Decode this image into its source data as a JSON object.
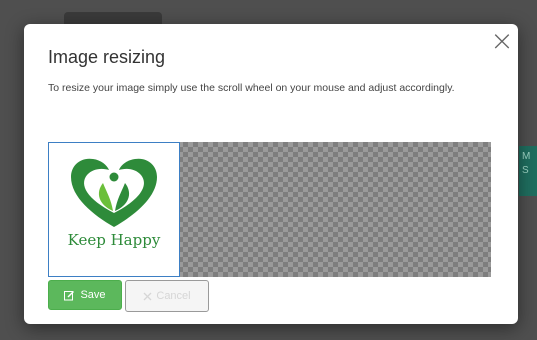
{
  "modal": {
    "title": "Image resizing",
    "description": "To resize your image simply use the scroll wheel on your mouse and adjust accordingly.",
    "close_glyph": "×"
  },
  "image": {
    "logo_text": "Keep Happy"
  },
  "buttons": {
    "save_label": "Save",
    "cancel_label": "Cancel"
  },
  "background": {
    "teal_text": "M\nS"
  },
  "colors": {
    "save": "#5cb85c",
    "logo_green": "#2e8b3a",
    "frame_border": "#3d7fc4"
  },
  "icons": {
    "save": "edit-icon",
    "cancel": "close-icon",
    "close": "close-icon"
  }
}
